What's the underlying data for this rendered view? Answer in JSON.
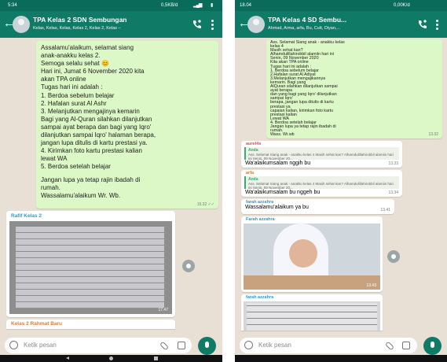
{
  "left": {
    "status": {
      "time": "5:34",
      "net": "0,5KB/d",
      "signal": "▂▄▆",
      "battery": "▮"
    },
    "header": {
      "title": "TPA Kelas 2 SDN Sembungan",
      "subtitle": "Kelas, Kelas, Kelas, Kelas 2, Kelas 2, Kelas –"
    },
    "message": {
      "lines": [
        "Assalamu'alaikum, selamat siang",
        "anak-anakku kelas 2.",
        "Semoga selalu sehat 😊",
        "Hari ini, Jumat 6 November 2020 kita",
        "akan TPA online",
        "Tugas hari ini adalah :",
        "1. Berdoa sebelum belajar",
        "2. Hafalan surat Al Ashr",
        "3. Melanjutkan mengajinya kemarin",
        "Bagi yang Al-Quran silahkan dilanjutkan",
        "sampai ayat berapa dan bagi yang Iqro'",
        "dilanjutkan sampai Iqro' halaman berapa,",
        "jangan lupa ditulis di kartu prestasi ya.",
        "4. Kirimkan foto kartu prestasi kalian",
        "lewat WA",
        "5. Berdoa setelah belajar",
        "",
        "Jangan lupa ya tetap rajin ibadah di",
        "rumah.",
        "Wassalamu'alaikum Wr. Wb."
      ],
      "time": "15.32 ✓✓"
    },
    "photo_message": {
      "sender": "Rafif Kelas 2",
      "time": "17.47"
    },
    "next_sender": "Kelas 2 Rahmat Baru",
    "input_placeholder": "Ketik pesan"
  },
  "right": {
    "status": {
      "time": "18.04",
      "net": "0,00K/d"
    },
    "header": {
      "title": "TPA Kelas 4 SD Sembu...",
      "subtitle": "Ahmad, Arma, arfa, Bu, Cutt, Diyan,..."
    },
    "message": {
      "lines": [
        "Ass. Selamat Siang anak - anakku kelas",
        "kelas 4",
        "Masih sehat kan?",
        "Alhamdulillahirobbil alamiin hari ini",
        "Senin, 09 November 2020",
        "Kita akan TPA online",
        "Tugas hari ini adalah :",
        "1. Berdoa sebelum belajar",
        "2.Hafalan surat Al Adiyat",
        "3.Melanjutkan mengajikannya",
        "kemarin. Bagi yang",
        "AlQuran silahkan dilanjutkan sampai",
        "ayat berapa",
        "dan yang bagi yang Iqro' dilanjutkan",
        "sampai Iqro'",
        "berapa, jangan lupa ditulis di kartu",
        "prestasi ya",
        "capaian kalian, kirimkan foto kartu",
        "prestasi kalian",
        "Lewat WA",
        "4. Berdoa setelah belajar",
        "Jangan lupa ya tetap rajin ibadah di",
        "rumah.",
        "Wass. Wr.wb"
      ],
      "time": "13.32"
    },
    "reply1": {
      "sender": "aurel4s",
      "quote_name": "Anda",
      "quote": "Ass. Selamat Siang anak - anakku kelas 4 Masih sehat kan? Alhamdulillahirobbil alamiin hari ini Senin, 09 November 20...",
      "text": "Wa'alaikumsalam nggih bu",
      "time": "13.33"
    },
    "reply2": {
      "sender": "arfa",
      "quote_name": "Anda",
      "quote": "Ass. Selamat Siang anak - anakku kelas 4 Masih sehat kan? Alhamdulillahirobbil alamiin hari ini Senin, 09 November 20...",
      "text": "Wa'alaikumsalam bu nggeh bu",
      "time": "13.34"
    },
    "reply3": {
      "sender": "farah azzahra",
      "text": "Wassalamu'alaikum ya bu",
      "time": "13.41"
    },
    "photo1": {
      "sender": "Farah azzahra",
      "time": "13.43"
    },
    "photo2": {
      "sender": "farah azzahra"
    },
    "input_placeholder": "Ketik pesan"
  }
}
